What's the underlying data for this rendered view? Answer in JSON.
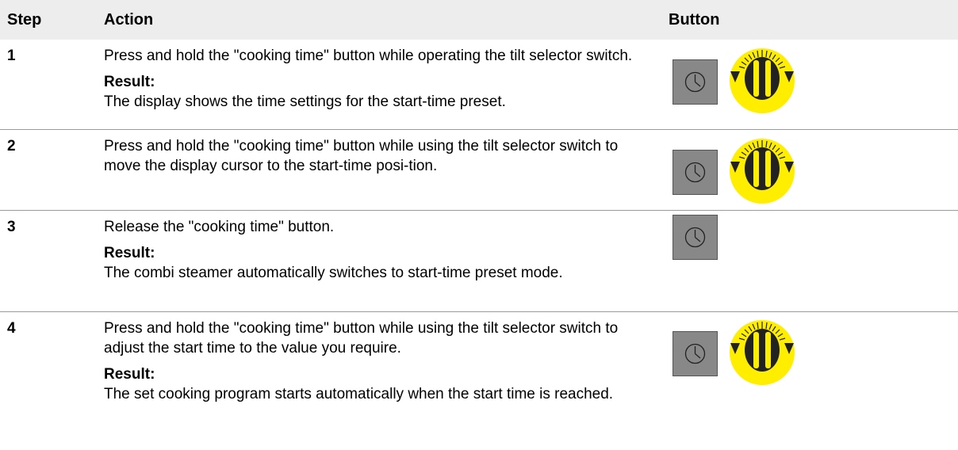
{
  "header": {
    "step": "Step",
    "action": "Action",
    "button": "Button"
  },
  "rows": [
    {
      "step": "1",
      "action": "Press and hold the \"cooking time\" button while operating the tilt selector switch.",
      "result_label": "Result:",
      "result": "The display shows the time settings for the start-time preset.",
      "icons": [
        "clock-icon",
        "tilt-selector-knob-icon"
      ]
    },
    {
      "step": "2",
      "action": "Press and hold the \"cooking time\" button while using the tilt selector switch to move the display cursor to the start-time posi-tion.",
      "icons": [
        "clock-icon",
        "tilt-selector-knob-icon"
      ]
    },
    {
      "step": "3",
      "action": "Release the \"cooking time\" button.",
      "result_label": "Result:",
      "result": "The combi steamer automatically switches to start-time preset mode.",
      "icons": [
        "clock-icon"
      ]
    },
    {
      "step": "4",
      "action": "Press and hold the \"cooking time\" button while using the tilt selector switch to adjust the start time to the value you require.",
      "result_label": "Result:",
      "result": "The set cooking program starts automatically when the start time is reached.",
      "icons": [
        "clock-icon",
        "tilt-selector-knob-icon"
      ]
    }
  ],
  "colors": {
    "header_bg": "#ededed",
    "button_gray": "#888888",
    "knob_yellow": "#ffee00"
  }
}
